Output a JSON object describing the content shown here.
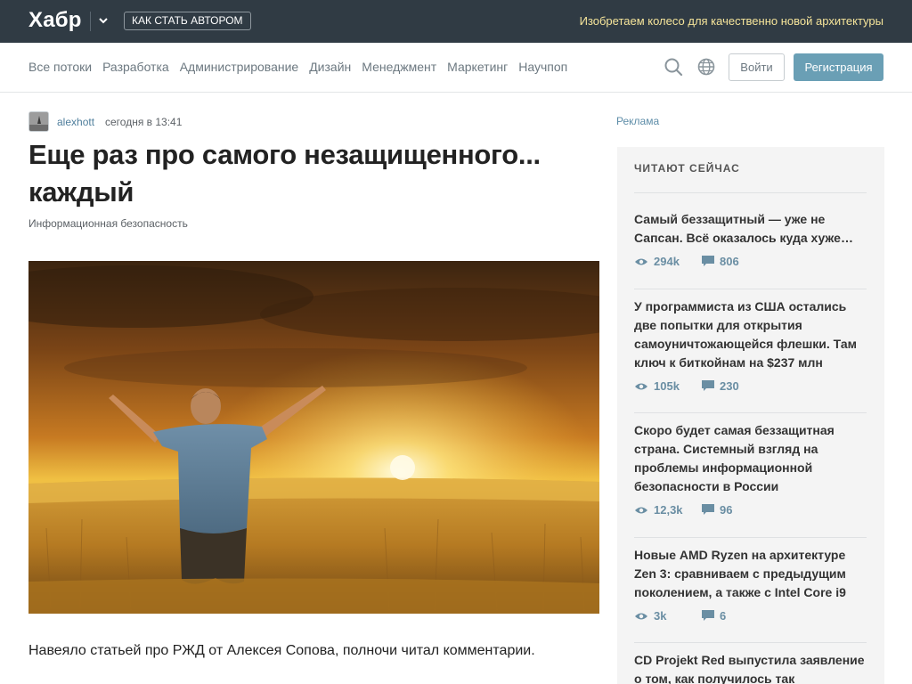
{
  "header": {
    "logo": "Хабр",
    "author_button": "КАК СТАТЬ АВТОРОМ",
    "slogan": "Изобретаем колесо для качественно новой архитектуры"
  },
  "nav": {
    "items": [
      "Все потоки",
      "Разработка",
      "Администрирование",
      "Дизайн",
      "Менеджмент",
      "Маркетинг",
      "Научпоп"
    ],
    "login": "Войти",
    "register": "Регистрация"
  },
  "article": {
    "author": "alexhott",
    "time": "сегодня в 13:41",
    "title": "Еще раз про самого незащищенного... каждый",
    "hub": "Информационная безопасность",
    "lead": "Навеяло статьей про РЖД от Алексея Сопова, полночи читал комментарии."
  },
  "sidebar": {
    "ad_label": "Реклама",
    "heading": "ЧИТАЮТ СЕЙЧАС",
    "items": [
      {
        "title": "Самый беззащитный — уже не Сапсан. Всё оказалось куда хуже…",
        "views": "294k",
        "comments": "806"
      },
      {
        "title": "У программиста из США остались две попытки для открытия самоуничтожающейся флешки. Там ключ к биткойнам на $237 млн",
        "views": "105k",
        "comments": "230"
      },
      {
        "title": "Скоро будет самая беззащитная страна. Системный взгляд на проблемы информационной безопасности в России",
        "views": "12,3k",
        "comments": "96"
      },
      {
        "title": "Новые AMD Ryzen на архитектуре Zen 3: сравниваем с предыдущим поколением, а также с Intel Core i9",
        "views": "3k",
        "comments": "6"
      },
      {
        "title": "CD Projekt Red выпустила заявление о том, как получилось так напортачить с"
      }
    ]
  },
  "colors": {
    "topbar": "#303b44",
    "accent": "#6a9fb5",
    "slogan": "#f5e49a"
  }
}
